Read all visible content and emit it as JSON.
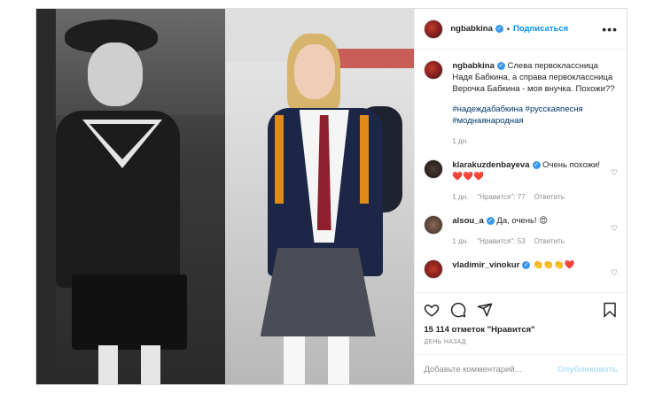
{
  "post": {
    "username": "ngbabkina",
    "follow_label": "Подписаться",
    "more_label": "•••",
    "caption_user": "ngbabkina",
    "caption_text": "Слева первоклассница Надя Бабкина, а справа первоклассница Верочка Бабкина - моя внучка. Похожи??",
    "hashtags_line1": "#надеждабабкина #русскаяпесня",
    "hashtags_line2": "#моднаянародная",
    "caption_time": "1 дн.",
    "likes": "15 114 отметок \"Нравится\"",
    "date": "ДЕНЬ НАЗАД",
    "comment_placeholder": "Добавьте комментарий...",
    "publish_label": "Опубликовать"
  },
  "comments": [
    {
      "user": "klarakuzdenbayeva",
      "text": "Очень похожи!",
      "hearts": "❤️❤️❤️",
      "time": "1 дн.",
      "likes": "\"Нравится\": 77",
      "reply": "Ответить"
    },
    {
      "user": "alsou_a",
      "text": "Да, очень!",
      "hearts": "😍",
      "time": "1 дн.",
      "likes": "\"Нравится\": 53",
      "reply": "Ответить"
    },
    {
      "user": "vladimir_vinokur",
      "text": "",
      "hearts": "👏👏👏❤️"
    }
  ],
  "icons": {
    "like": "heart-icon",
    "comment": "comment-icon",
    "share": "share-icon",
    "save": "bookmark-icon"
  },
  "colors": {
    "link": "#0095f6",
    "verified": "#3897f0",
    "publish_disabled": "#b2dffc"
  }
}
